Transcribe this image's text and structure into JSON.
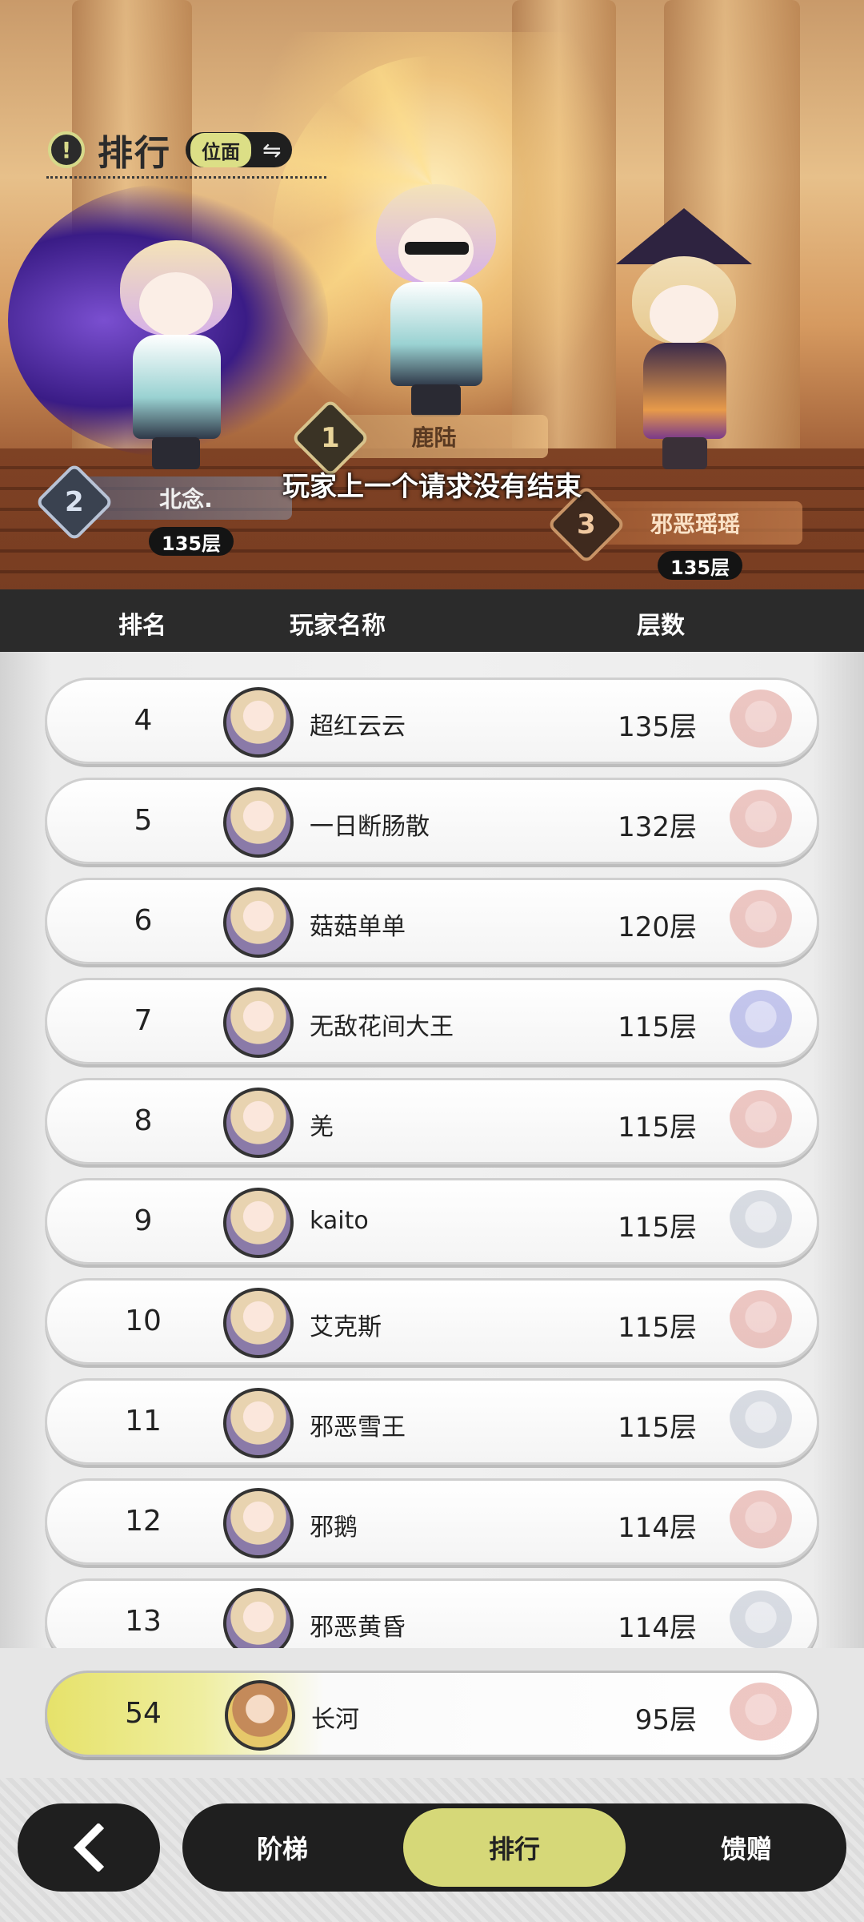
{
  "header": {
    "title": "排行",
    "dimension_label": "位面",
    "alert_icon": "exclamation-icon",
    "swap_icon": "swap-arrows-icon"
  },
  "podium": [
    {
      "rank": "1",
      "name": "鹿陆",
      "floors": ""
    },
    {
      "rank": "2",
      "name": "北念.",
      "floors": "135层"
    },
    {
      "rank": "3",
      "name": "邪恶瑶瑶",
      "floors": "135层"
    }
  ],
  "error_message": "玩家上一个请求没有结束",
  "table": {
    "columns": {
      "rank": "排名",
      "name": "玩家名称",
      "floors": "层数"
    },
    "rows": [
      {
        "rank": "4",
        "name": "超红云云",
        "floors": "135层"
      },
      {
        "rank": "5",
        "name": "一日断肠散",
        "floors": "132层"
      },
      {
        "rank": "6",
        "name": "菇菇单单",
        "floors": "120层"
      },
      {
        "rank": "7",
        "name": "无敌花间大王",
        "floors": "115层"
      },
      {
        "rank": "8",
        "name": "羌",
        "floors": "115层"
      },
      {
        "rank": "9",
        "name": "kaito",
        "floors": "115层"
      },
      {
        "rank": "10",
        "name": "艾克斯",
        "floors": "115层"
      },
      {
        "rank": "11",
        "name": "邪恶雪王",
        "floors": "115层"
      },
      {
        "rank": "12",
        "name": "邪鹅",
        "floors": "114层"
      },
      {
        "rank": "13",
        "name": "邪恶黄昏",
        "floors": "114层"
      }
    ]
  },
  "self_row": {
    "rank": "54",
    "name": "长河",
    "floors": "95层"
  },
  "nav": {
    "back_icon": "chevron-left-icon",
    "tabs": [
      {
        "label": "阶梯",
        "active": false
      },
      {
        "label": "排行",
        "active": true
      },
      {
        "label": "馈赠",
        "active": false
      }
    ]
  },
  "colors": {
    "accent": "#d6d878",
    "dark": "#1f1f1f",
    "header_bar": "#2b2b2b"
  }
}
